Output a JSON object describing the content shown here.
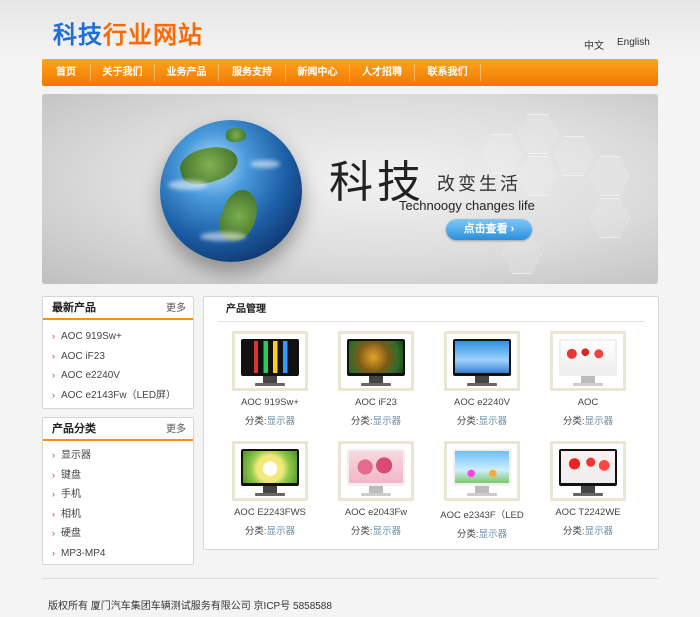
{
  "header": {
    "logo_part1": "科技",
    "logo_part2": "行业网站",
    "lang_zh": "中文",
    "lang_en": "English"
  },
  "nav": {
    "items": [
      "首页",
      "关于我们",
      "业务产品",
      "服务支持",
      "新闻中心",
      "人才招聘",
      "联系我们"
    ]
  },
  "banner": {
    "title": "科技",
    "subtitle": "改变生活",
    "en": "Technoogy changes life",
    "button": "点击查看 ›"
  },
  "latest": {
    "title": "最新产品",
    "more": "更多",
    "items": [
      "AOC 919Sw+",
      "AOC iF23",
      "AOC e2240V",
      "AOC e2143Fw（LED屏）"
    ]
  },
  "categories": {
    "title": "产品分类",
    "more": "更多",
    "items": [
      "显示器",
      "键盘",
      "手机",
      "相机",
      "硬盘",
      "MP3-MP4"
    ]
  },
  "products": {
    "title": "产品管理",
    "cat_label": "分类:",
    "items": [
      {
        "name": "AOC 919Sw+",
        "cat": "显示器"
      },
      {
        "name": "AOC iF23",
        "cat": "显示器"
      },
      {
        "name": "AOC e2240V",
        "cat": "显示器"
      },
      {
        "name": "AOC",
        "cat": "显示器"
      },
      {
        "name": "AOC E2243FWS",
        "cat": "显示器"
      },
      {
        "name": "AOC e2043Fw",
        "cat": "显示器"
      },
      {
        "name": "AOC e2343F（LED",
        "cat": "显示器"
      },
      {
        "name": "AOC T2242WE",
        "cat": "显示器"
      }
    ]
  },
  "footer": {
    "text": "版权所有 厦门汽车集团车辆测试服务有限公司   京ICP号 5858588"
  },
  "colors": {
    "accent_orange": "#f58a0b",
    "logo_blue": "#1f6fd6",
    "logo_orange": "#ff6a00",
    "button_blue": "#2b8fdc"
  }
}
